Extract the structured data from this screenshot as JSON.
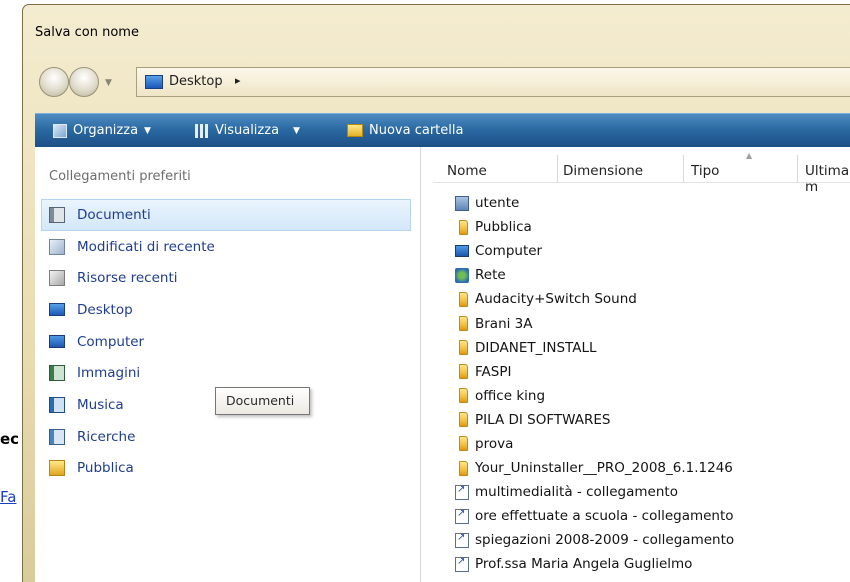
{
  "background": {
    "text1": "ec",
    "text2": "Fa"
  },
  "window": {
    "title": "Salva con nome"
  },
  "address": {
    "location": "Desktop",
    "chevron": "▸"
  },
  "toolbar": {
    "organize": "Organizza",
    "view": "Visualizza",
    "new_folder": "Nuova cartella"
  },
  "left_pane": {
    "title": "Collegamenti preferiti",
    "items": [
      {
        "label": "Documenti",
        "icon": "documents-icon"
      },
      {
        "label": "Modificati di recente",
        "icon": "recent-changes-icon"
      },
      {
        "label": "Risorse recenti",
        "icon": "recent-places-icon"
      },
      {
        "label": "Desktop",
        "icon": "desktop-icon"
      },
      {
        "label": "Computer",
        "icon": "computer-icon"
      },
      {
        "label": "Immagini",
        "icon": "pictures-icon"
      },
      {
        "label": "Musica",
        "icon": "music-icon"
      },
      {
        "label": "Ricerche",
        "icon": "searches-icon"
      },
      {
        "label": "Pubblica",
        "icon": "public-folder-icon"
      }
    ]
  },
  "tooltip": {
    "text": "Documenti"
  },
  "columns": {
    "name": "Nome",
    "size": "Dimensione",
    "type": "Tipo",
    "modified": "Ultima m"
  },
  "files": [
    {
      "name": "utente",
      "icon": "user-folder-icon"
    },
    {
      "name": "Pubblica",
      "icon": "folder-icon"
    },
    {
      "name": "Computer",
      "icon": "computer-icon"
    },
    {
      "name": "Rete",
      "icon": "network-icon"
    },
    {
      "name": "Audacity+Switch Sound",
      "icon": "folder-icon"
    },
    {
      "name": "Brani 3A",
      "icon": "folder-icon"
    },
    {
      "name": "DIDANET_INSTALL",
      "icon": "folder-icon"
    },
    {
      "name": "FASPI",
      "icon": "folder-icon"
    },
    {
      "name": "office king",
      "icon": "folder-icon"
    },
    {
      "name": "PILA DI SOFTWARES",
      "icon": "folder-icon"
    },
    {
      "name": "prova",
      "icon": "folder-icon"
    },
    {
      "name": "Your_Uninstaller__PRO_2008_6.1.1246",
      "icon": "folder-icon"
    },
    {
      "name": "multimedialità - collegamento",
      "icon": "shortcut-icon"
    },
    {
      "name": "ore effettuate a scuola - collegamento",
      "icon": "shortcut-icon"
    },
    {
      "name": "spiegazioni 2008-2009 - collegamento",
      "icon": "shortcut-icon"
    },
    {
      "name": "Prof.ssa Maria Angela Guglielmo",
      "icon": "shortcut-icon"
    }
  ]
}
